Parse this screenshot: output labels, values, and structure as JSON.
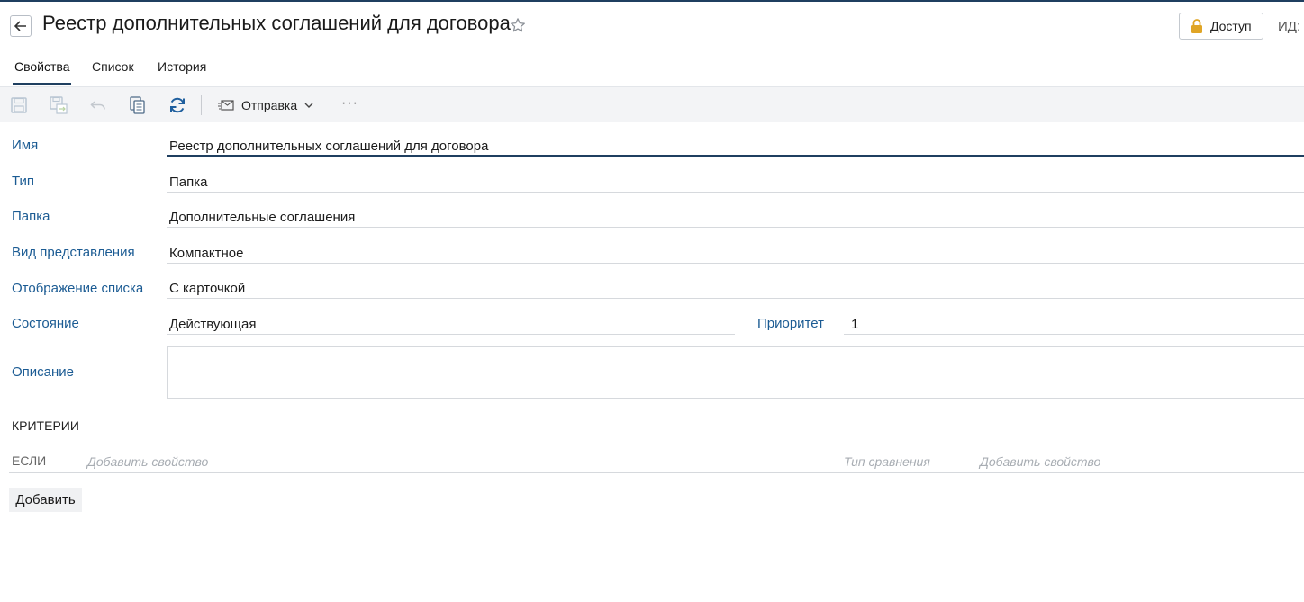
{
  "header": {
    "title": "Реестр дополнительных соглашений для договора",
    "access_label": "Доступ",
    "id_label": "ИД:"
  },
  "tabs": [
    {
      "label": "Свойства",
      "active": true
    },
    {
      "label": "Список",
      "active": false
    },
    {
      "label": "История",
      "active": false
    }
  ],
  "toolbar": {
    "send_label": "Отправка",
    "more_label": "···"
  },
  "form": {
    "name_label": "Имя",
    "name_value": "Реестр дополнительных соглашений для договора",
    "type_label": "Тип",
    "type_value": "Папка",
    "folder_label": "Папка",
    "folder_value": "Дополнительные соглашения",
    "view_label": "Вид представления",
    "view_value": "Компактное",
    "display_label": "Отображение списка",
    "display_value": "С карточкой",
    "state_label": "Состояние",
    "state_value": "Действующая",
    "priority_label": "Приоритет",
    "priority_value": "1",
    "description_label": "Описание",
    "description_value": ""
  },
  "criteria": {
    "section_title": "КРИТЕРИИ",
    "if_label": "ЕСЛИ",
    "property_placeholder": "Добавить свойство",
    "comparison_placeholder": "Тип сравнения",
    "value_placeholder": "Добавить свойство",
    "add_button": "Добавить"
  },
  "colors": {
    "accent": "#1f3f60",
    "label": "#1b5b93",
    "toolbar_bg": "#f3f4f6",
    "lock": "#e0a526"
  }
}
